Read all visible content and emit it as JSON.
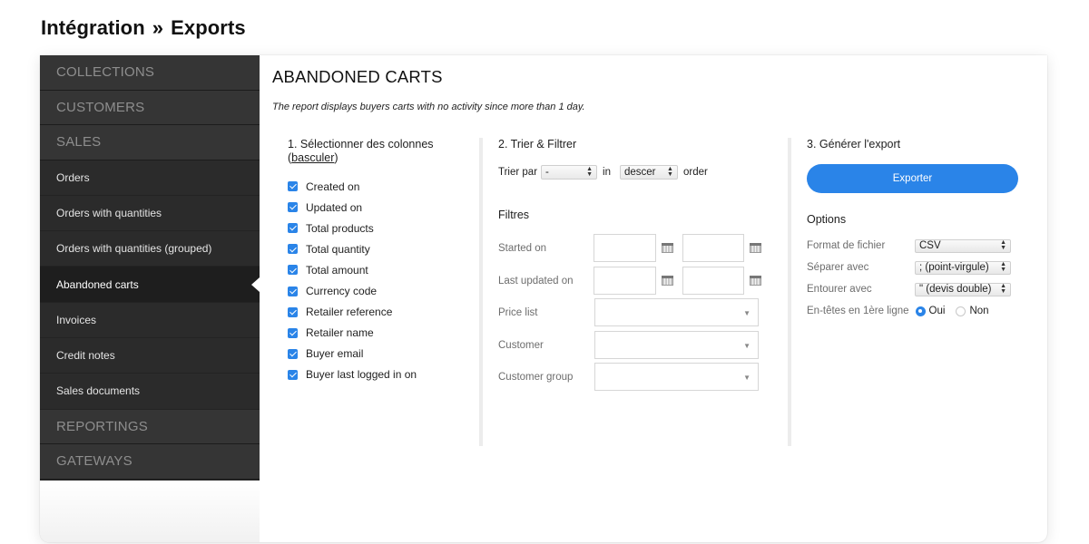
{
  "page": {
    "breadcrumb_parent": "Intégration",
    "breadcrumb_separator": "»",
    "breadcrumb_current": "Exports"
  },
  "sidebar": {
    "sections": {
      "collections": "COLLECTIONS",
      "customers": "CUSTOMERS",
      "sales": "SALES",
      "reportings": "REPORTINGS",
      "gateways": "GATEWAYS"
    },
    "sales_items": [
      "Orders",
      "Orders with quantities",
      "Orders with quantities (grouped)",
      "Abandoned carts",
      "Invoices",
      "Credit notes",
      "Sales documents"
    ],
    "active_item": "Abandoned carts"
  },
  "main": {
    "title": "ABANDONED CARTS",
    "description": "The report displays buyers carts with no activity since more than 1 day."
  },
  "columns": {
    "heading": "1. Sélectionner des colonnes",
    "toggle_link": "basculer",
    "items": [
      {
        "label": "Created on",
        "checked": true
      },
      {
        "label": "Updated on",
        "checked": true
      },
      {
        "label": "Total products",
        "checked": true
      },
      {
        "label": "Total quantity",
        "checked": true
      },
      {
        "label": "Total amount",
        "checked": true
      },
      {
        "label": "Currency code",
        "checked": true
      },
      {
        "label": "Retailer reference",
        "checked": true
      },
      {
        "label": "Retailer name",
        "checked": true
      },
      {
        "label": "Buyer email",
        "checked": true
      },
      {
        "label": "Buyer last logged in on",
        "checked": true
      }
    ]
  },
  "sort_filter": {
    "heading": "2. Trier & Filtrer",
    "sort_by_label": "Trier par",
    "sort_by_value": "-",
    "in_label": "in",
    "order_value": "descer",
    "order_label": "order",
    "filters_heading": "Filtres",
    "filters": {
      "started_on": "Started on",
      "last_updated_on": "Last updated on",
      "price_list": "Price list",
      "customer": "Customer",
      "customer_group": "Customer group"
    }
  },
  "export": {
    "heading": "3. Générer l'export",
    "button": "Exporter",
    "options_heading": "Options",
    "file_format_label": "Format de fichier",
    "file_format_value": "CSV",
    "separator_label": "Séparer avec",
    "separator_value": "; (point-virgule)",
    "enclosure_label": "Entourer avec",
    "enclosure_value": "\" (devis double)",
    "headers_label": "En-têtes en 1ère ligne",
    "headers_yes": "Oui",
    "headers_no": "Non",
    "headers_selected": "Oui"
  },
  "colors": {
    "accent": "#2a84e8",
    "sidebar_bg": "#2b2b2b",
    "sidebar_active": "#1e1e1e"
  }
}
